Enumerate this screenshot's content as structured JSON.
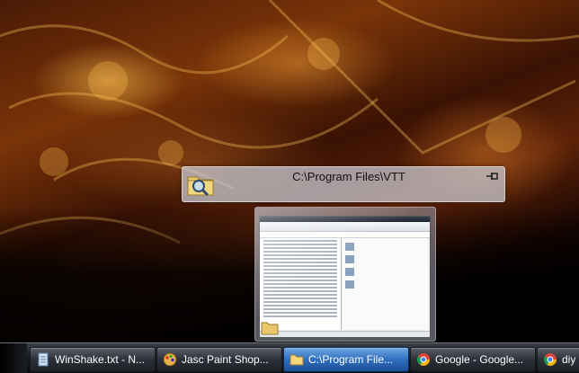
{
  "window_title": "C:\\Program Files\\VTT",
  "taskbar": {
    "buttons": [
      {
        "label": "WinShake.txt - N...",
        "icon": "notepad-icon"
      },
      {
        "label": "Jasc Paint Shop...",
        "icon": "paint-shop-icon"
      },
      {
        "label": "C:\\Program File...",
        "icon": "folder-icon",
        "active": true
      },
      {
        "label": "Google - Google...",
        "icon": "chrome-icon"
      },
      {
        "label": "diy",
        "icon": "chrome-icon"
      }
    ]
  },
  "colors": {
    "taskbar": "#1a1d22",
    "active_task": "#2f6fc0"
  }
}
